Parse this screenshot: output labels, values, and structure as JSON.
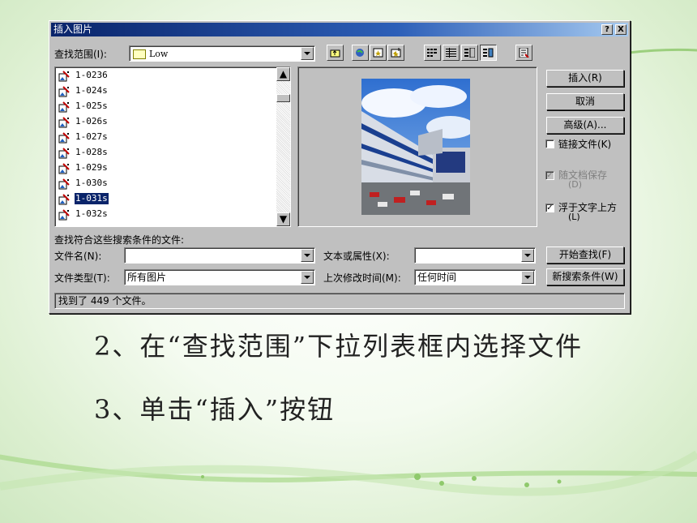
{
  "dialog": {
    "title": "插入图片",
    "help_btn": "?",
    "close_btn": "X",
    "look_in_label": "查找范围(I):",
    "look_in_value": "Low",
    "files": [
      "1-0236",
      "1-024s",
      "1-025s",
      "1-026s",
      "1-027s",
      "1-028s",
      "1-029s",
      "1-030s",
      "1-031s",
      "1-032s"
    ],
    "selected_file": "1-031s",
    "buttons": {
      "insert": "插入(R)",
      "cancel": "取消",
      "advanced": "高级(A)...",
      "start_search": "开始查找(F)",
      "new_search": "新搜索条件(W)"
    },
    "checkboxes": {
      "link_file": {
        "label": "链接文件(K)",
        "checked": false
      },
      "save_with_doc": {
        "label": "随文档保存",
        "sub": "(D)",
        "checked": true,
        "disabled": true
      },
      "float_over_text": {
        "label": "浮于文字上方",
        "sub": "(L)",
        "checked": true
      }
    },
    "search_hint": "查找符合这些搜索条件的文件:",
    "filename_label": "文件名(N):",
    "filename_value": "",
    "filetype_label": "文件类型(T):",
    "filetype_value": "所有图片",
    "text_prop_label": "文本或属性(X):",
    "text_prop_value": "",
    "last_modified_label": "上次修改时间(M):",
    "last_modified_value": "任何时间",
    "status": "找到了 449 个文件。"
  },
  "captions": {
    "step2": "2、在“查找范围”下拉列表框内选择文件",
    "step3": "3、单击“插入”按钮"
  }
}
